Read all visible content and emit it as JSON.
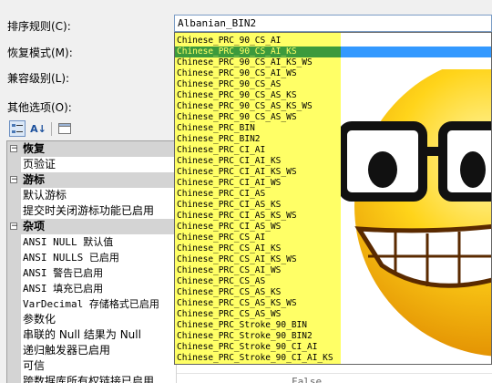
{
  "labels": {
    "collation": "排序规则(C):",
    "recovery": "恢复模式(M):",
    "compat": "兼容级别(L):",
    "other": "其他选项(O):"
  },
  "collation_value": "Albanian_BIN2",
  "toolbar": {
    "categorized_icon": "categorized-icon",
    "alpha_icon": "sort-az-icon",
    "alpha_glyph": "A↓",
    "pages_icon": "property-pages-icon"
  },
  "grid": {
    "rows": [
      {
        "type": "cat",
        "label": "恢复"
      },
      {
        "type": "prop",
        "label": "页验证"
      },
      {
        "type": "cat",
        "label": "游标"
      },
      {
        "type": "prop",
        "label": "默认游标"
      },
      {
        "type": "prop",
        "label": "提交时关闭游标功能已启用"
      },
      {
        "type": "cat",
        "label": "杂项"
      },
      {
        "type": "prop",
        "label": "ANSI NULL 默认值"
      },
      {
        "type": "prop",
        "label": "ANSI NULLS 已启用"
      },
      {
        "type": "prop",
        "label": "ANSI 警告已启用"
      },
      {
        "type": "prop",
        "label": "ANSI 填充已启用"
      },
      {
        "type": "prop",
        "label": "VarDecimal 存储格式已启用"
      },
      {
        "type": "prop",
        "label": "参数化"
      },
      {
        "type": "prop",
        "label": "串联的 Null 结果为 Null"
      },
      {
        "type": "prop",
        "label": "递归触发器已启用"
      },
      {
        "type": "prop",
        "label": "可信"
      },
      {
        "type": "prop",
        "label": "跨数据库所有权链接已启用",
        "value": "False"
      }
    ]
  },
  "dropdown": {
    "items": [
      "Chinese_PRC_90_CS_AI",
      "Chinese_PRC_90_CS_AI_KS",
      "Chinese_PRC_90_CS_AI_KS_WS",
      "Chinese_PRC_90_CS_AI_WS",
      "Chinese_PRC_90_CS_AS",
      "Chinese_PRC_90_CS_AS_KS",
      "Chinese_PRC_90_CS_AS_KS_WS",
      "Chinese_PRC_90_CS_AS_WS",
      "Chinese_PRC_BIN",
      "Chinese_PRC_BIN2",
      "Chinese_PRC_CI_AI",
      "Chinese_PRC_CI_AI_KS",
      "Chinese_PRC_CI_AI_KS_WS",
      "Chinese_PRC_CI_AI_WS",
      "Chinese_PRC_CI_AS",
      "Chinese_PRC_CI_AS_KS",
      "Chinese_PRC_CI_AS_KS_WS",
      "Chinese_PRC_CI_AS_WS",
      "Chinese_PRC_CS_AI",
      "Chinese_PRC_CS_AI_KS",
      "Chinese_PRC_CS_AI_KS_WS",
      "Chinese_PRC_CS_AI_WS",
      "Chinese_PRC_CS_AS",
      "Chinese_PRC_CS_AS_KS",
      "Chinese_PRC_CS_AS_KS_WS",
      "Chinese_PRC_CS_AS_WS",
      "Chinese_PRC_Stroke_90_BIN",
      "Chinese_PRC_Stroke_90_BIN2",
      "Chinese_PRC_Stroke_90_CI_AI",
      "Chinese_PRC_Stroke_90_CI_AI_KS"
    ],
    "selected_index": 1,
    "highlight_color": "#ffff66",
    "selected_color": "#3c9a3c"
  },
  "overlay_icon": "nerd-smiley-icon"
}
